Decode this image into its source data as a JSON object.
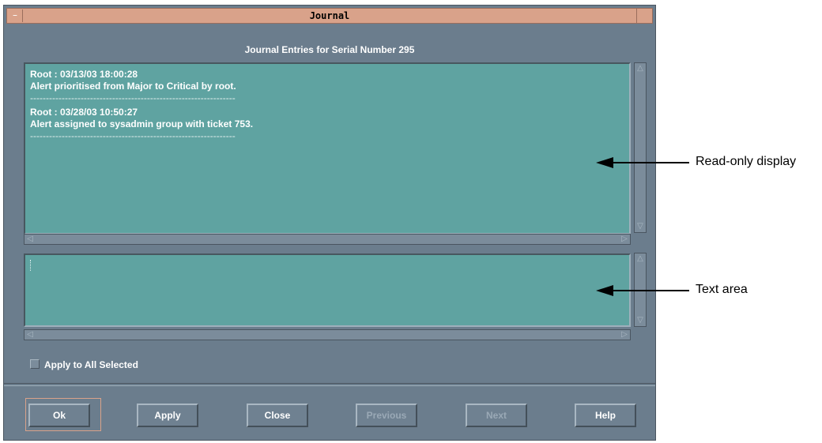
{
  "window": {
    "title": "Journal",
    "menu_glyph": "–"
  },
  "header": {
    "text": "Journal Entries for Serial Number 295"
  },
  "journal_entries": [
    {
      "heading": "Root : 03/13/03 18:00:28",
      "body": "Alert prioritised from Major to Critical by root.",
      "separator": "-----------------------------------------------------------------"
    },
    {
      "heading": "Root : 03/28/03 10:50:27",
      "body": "Alert assigned to sysadmin group with ticket 753.",
      "separator": "-----------------------------------------------------------------"
    }
  ],
  "text_area": {
    "value": ""
  },
  "checkbox": {
    "label": "Apply to All Selected",
    "checked": false
  },
  "buttons": {
    "ok": "Ok",
    "apply": "Apply",
    "close": "Close",
    "previous": "Previous",
    "next": "Next",
    "help": "Help"
  },
  "annotations": {
    "display": "Read-only display",
    "text_area": "Text area"
  },
  "icons": {
    "up": "up-arrow-icon",
    "down": "down-arrow-icon",
    "left": "left-arrow-icon",
    "right": "right-arrow-icon"
  },
  "colors": {
    "title_bar": "#d9a28a",
    "window": "#6b7d8d",
    "panel": "#5fa3a1"
  }
}
